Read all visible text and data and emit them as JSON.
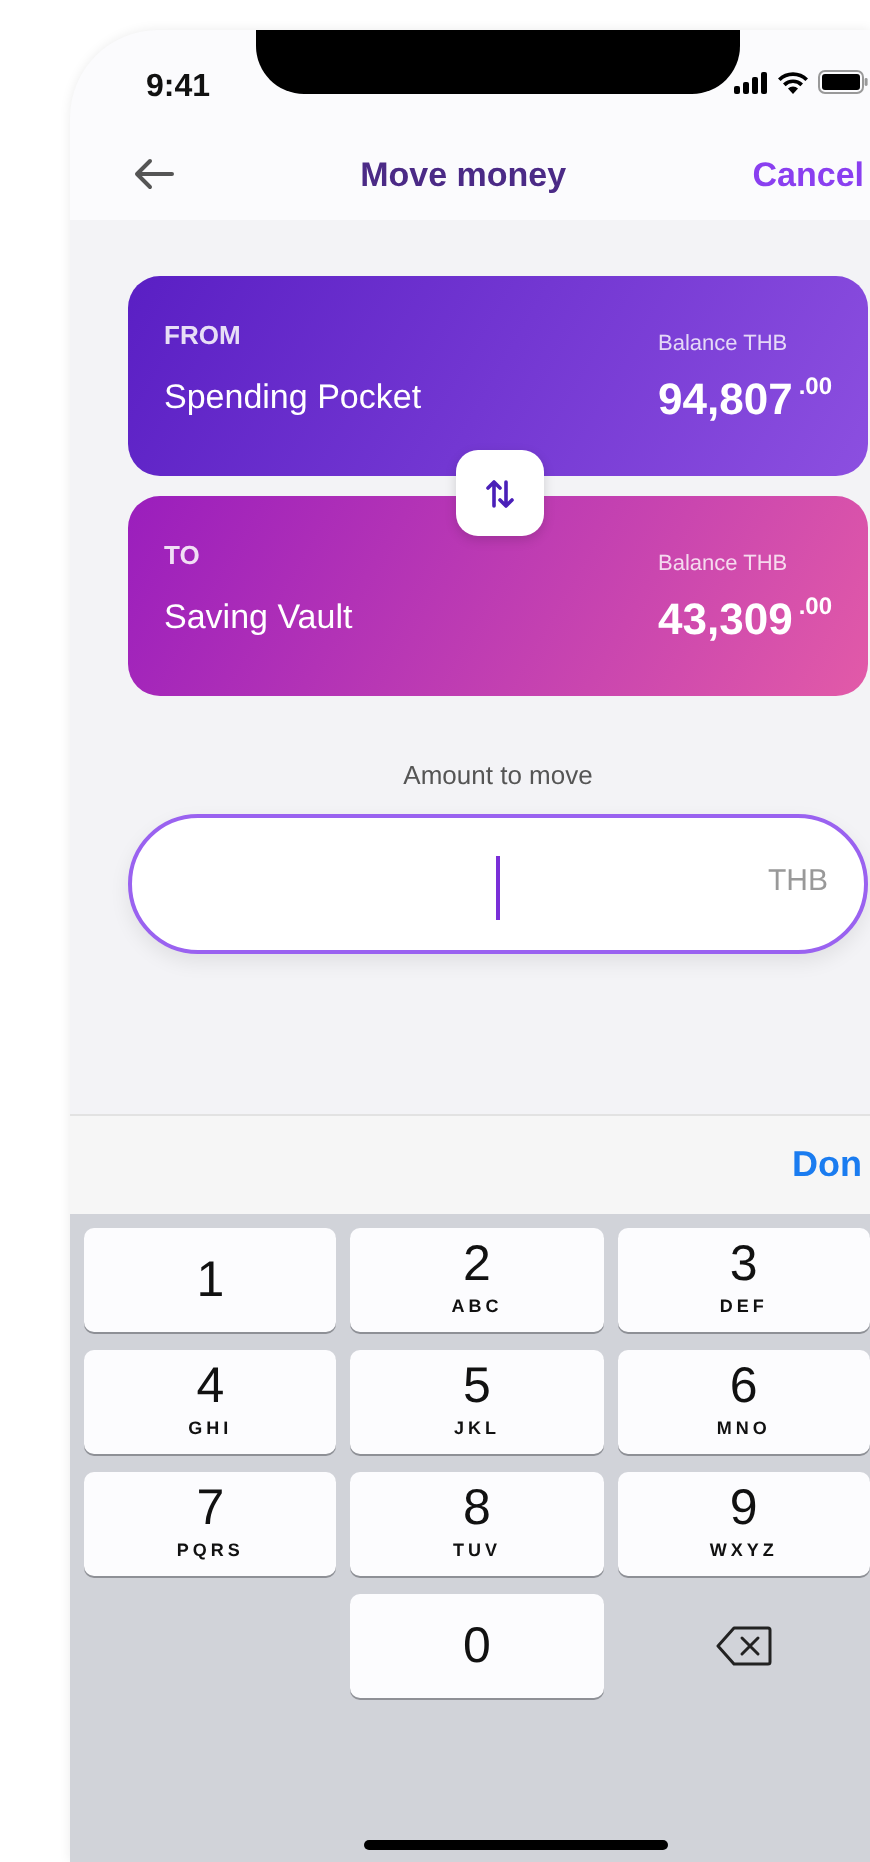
{
  "status_bar": {
    "time": "9:41"
  },
  "nav": {
    "title": "Move money",
    "action": "Cancel"
  },
  "accounts": [
    {
      "kind": "from",
      "direction": "FROM",
      "name": "Spending Pocket",
      "balance_label": "Balance THB",
      "amount": "94,807",
      "decimals": ".00"
    },
    {
      "kind": "to",
      "direction": "TO",
      "name": "Saving Vault",
      "balance_label": "Balance THB",
      "amount": "43,309",
      "decimals": ".00"
    }
  ],
  "amount_field": {
    "label": "Amount to move",
    "currency": "THB",
    "focused": true
  },
  "keyboard": {
    "accessory": "Don",
    "keys": [
      {
        "kind": "digit",
        "digit": "1"
      },
      {
        "kind": "digit",
        "digit": "2",
        "letters": "ABC"
      },
      {
        "kind": "digit",
        "digit": "3",
        "letters": "DEF"
      },
      {
        "kind": "digit",
        "digit": "4",
        "letters": "GHI"
      },
      {
        "kind": "digit",
        "digit": "5",
        "letters": "JKL"
      },
      {
        "kind": "digit",
        "digit": "6",
        "letters": "MNO"
      },
      {
        "kind": "digit",
        "digit": "7",
        "letters": "PQRS"
      },
      {
        "kind": "digit",
        "digit": "8",
        "letters": "TUV"
      },
      {
        "kind": "digit",
        "digit": "9",
        "letters": "WXYZ"
      },
      {
        "kind": "blank"
      },
      {
        "kind": "digit",
        "digit": "0"
      },
      {
        "kind": "delete"
      }
    ]
  }
}
